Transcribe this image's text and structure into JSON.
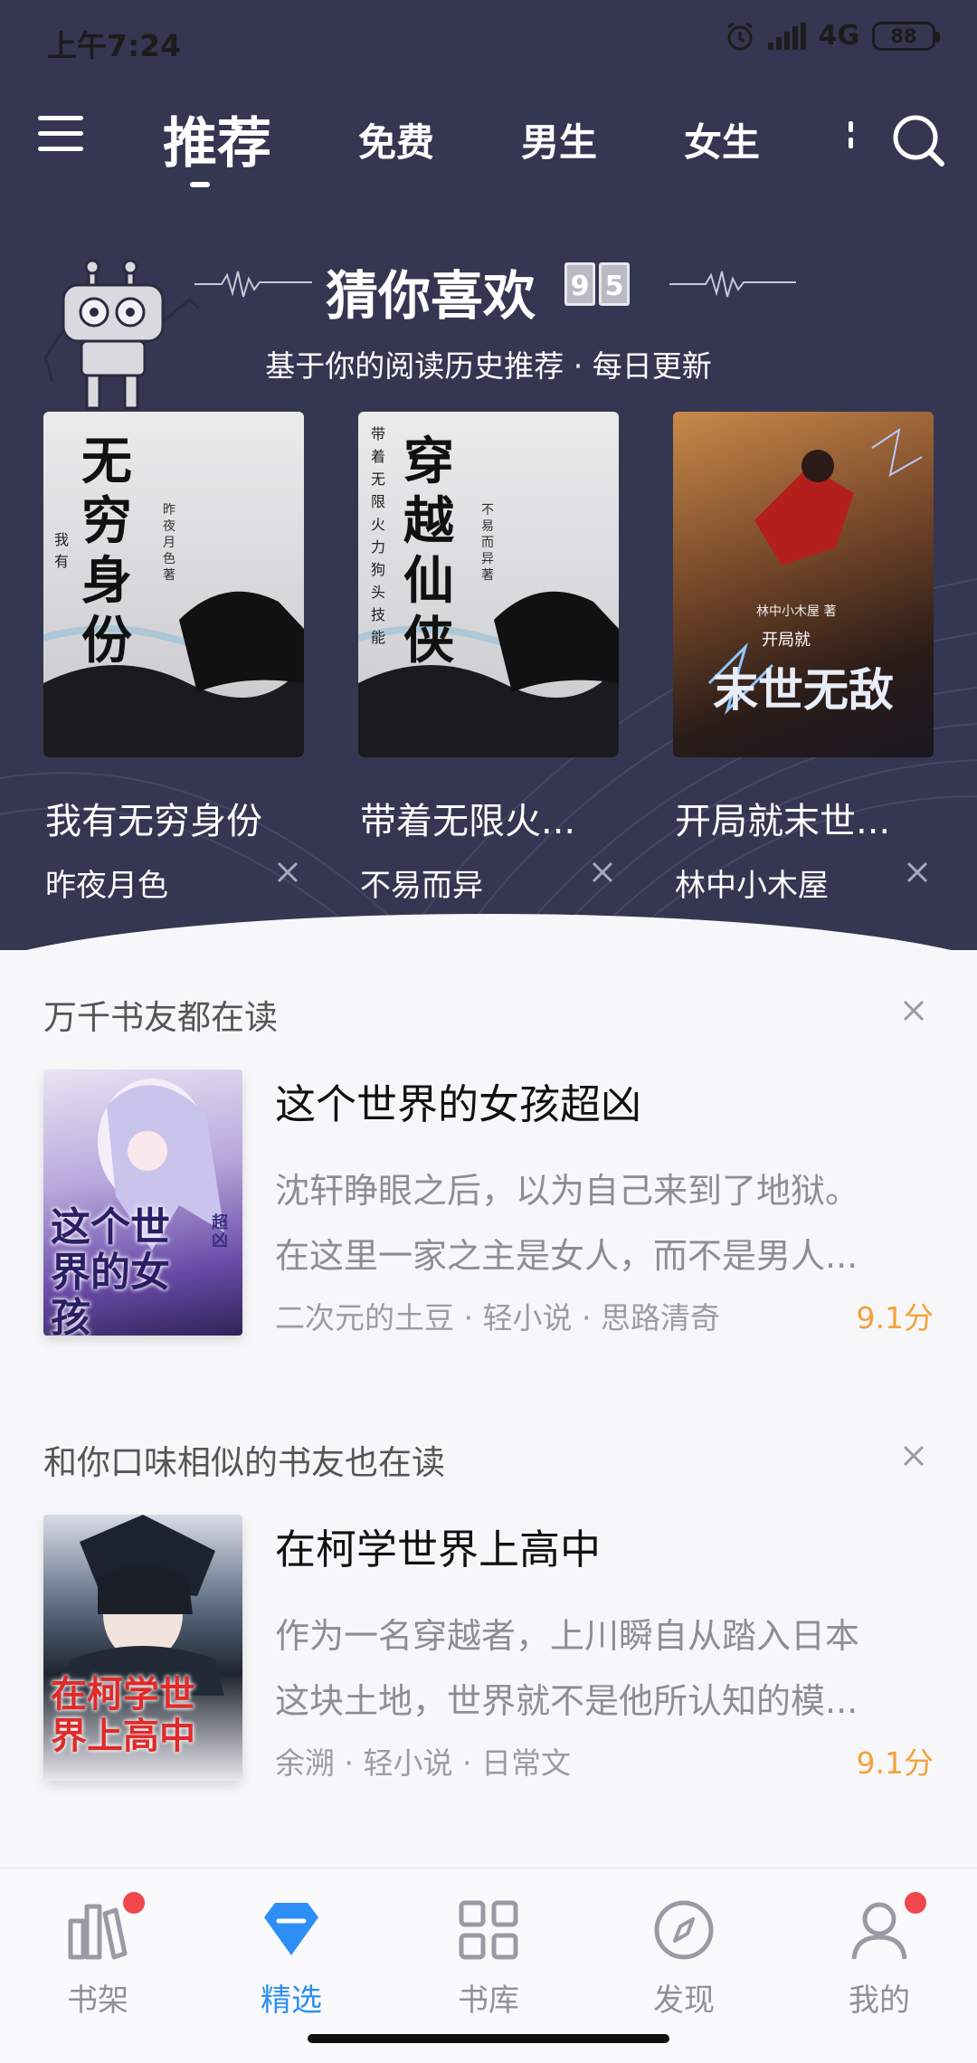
{
  "status_bar": {
    "time": "上午7:24",
    "network": "4G",
    "battery": "88"
  },
  "top_nav": {
    "tabs": [
      {
        "label": "推荐",
        "active": true
      },
      {
        "label": "免费",
        "active": false
      },
      {
        "label": "男生",
        "active": false
      },
      {
        "label": "女生",
        "active": false
      }
    ]
  },
  "guess": {
    "title": "猜你喜欢",
    "date_digits": [
      "9",
      "5"
    ],
    "subtitle": "基于你的阅读历史推荐 · 每日更新",
    "books": [
      {
        "title": "我有无穷身份",
        "author": "昨夜月色",
        "cover_text": "无穷身份",
        "cover_side": "我有",
        "cover_author": "昨夜月色 著"
      },
      {
        "title": "带着无限火...",
        "author": "不易而异",
        "cover_text": "穿越仙侠",
        "cover_side": "带着无限火力狗头技能",
        "cover_author": "不易而异 著"
      },
      {
        "title": "开局就末世...",
        "author": "林中小木屋",
        "cover_text": "末世无敌",
        "cover_side": "开局就",
        "cover_author": "林中小木屋 著"
      }
    ]
  },
  "sections": [
    {
      "heading": "万千书友都在读",
      "book": {
        "title": "这个世界的女孩超凶",
        "desc_lines": [
          "沈轩睁眼之后，以为自己来到了地狱。",
          "在这里一家之主是女人，而不是男人..."
        ],
        "meta": "二次元的土豆 · 轻小说 · 思路清奇",
        "score": "9.1分",
        "cover_text": "这个世界的女孩",
        "cover_tag": "超凶"
      }
    },
    {
      "heading": "和你口味相似的书友也在读",
      "book": {
        "title": "在柯学世界上高中",
        "desc_lines": [
          "作为一名穿越者，上川瞬自从踏入日本",
          "这块土地，世界就不是他所认知的模..."
        ],
        "meta": "余溯 · 轻小说 · 日常文",
        "score": "9.1分",
        "cover_text": "在柯学世界上高中"
      }
    }
  ],
  "tabbar": [
    {
      "label": "书架",
      "icon": "bookshelf-icon",
      "active": false,
      "badge": true
    },
    {
      "label": "精选",
      "icon": "diamond-icon",
      "active": true,
      "badge": false
    },
    {
      "label": "书库",
      "icon": "grid-icon",
      "active": false,
      "badge": false
    },
    {
      "label": "发现",
      "icon": "compass-icon",
      "active": false,
      "badge": false
    },
    {
      "label": "我的",
      "icon": "user-icon",
      "active": false,
      "badge": true
    }
  ],
  "colors": {
    "hero_bg": "#353651",
    "accent": "#2d8ef5",
    "score": "#f3a23a",
    "badge": "#f0464c"
  }
}
